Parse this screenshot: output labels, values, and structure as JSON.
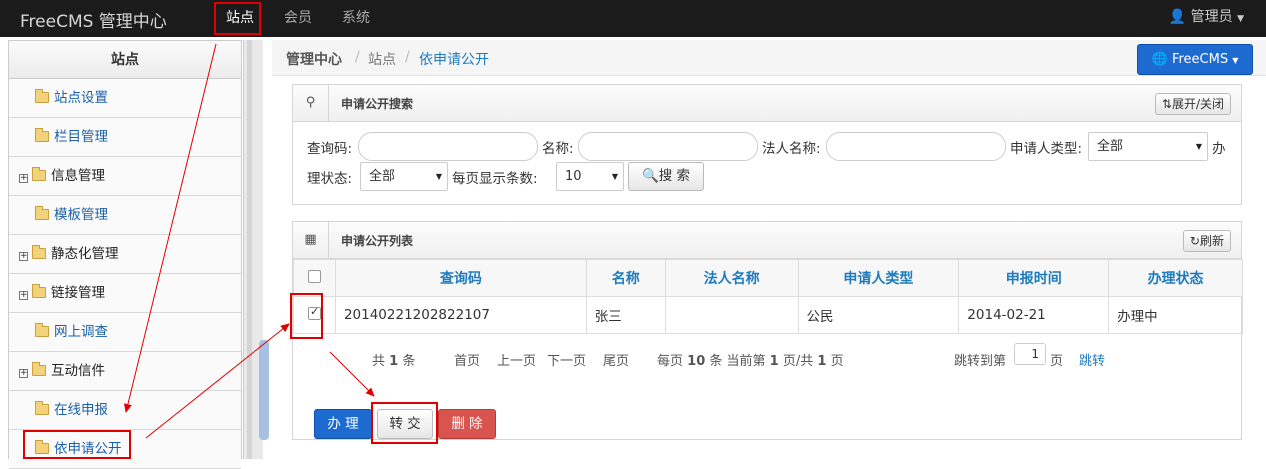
{
  "topbar": {
    "brand": "FreeCMS 管理中心",
    "nav": [
      "站点",
      "会员",
      "系统"
    ],
    "admin": "管理员"
  },
  "sidebar": {
    "title": "站点",
    "items": [
      {
        "label": "站点设置",
        "expandable": false
      },
      {
        "label": "栏目管理",
        "expandable": false
      },
      {
        "label": "信息管理",
        "expandable": true
      },
      {
        "label": "模板管理",
        "expandable": false
      },
      {
        "label": "静态化管理",
        "expandable": true
      },
      {
        "label": "链接管理",
        "expandable": true
      },
      {
        "label": "网上调查",
        "expandable": false
      },
      {
        "label": "互动信件",
        "expandable": true
      },
      {
        "label": "在线申报",
        "expandable": false
      },
      {
        "label": "依申请公开",
        "expandable": false
      }
    ]
  },
  "breadcrumb": {
    "items": [
      "管理中心",
      "站点",
      "依申请公开"
    ],
    "separator": "/"
  },
  "freecms_button": "FreeCMS",
  "search_panel": {
    "title": "申请公开搜索",
    "toggle_label": "展开/关闭",
    "query_code_label": "查询码:",
    "name_label": "名称:",
    "legal_name_label": "法人名称:",
    "applicant_type_label": "申请人类型:",
    "applicant_type_value": "全部",
    "status_label_part1": "办",
    "status_label_part2": "理状态:",
    "status_value": "全部",
    "page_size_label": "每页显示条数:",
    "page_size_value": "10",
    "search_button": "搜 索"
  },
  "list_panel": {
    "title": "申请公开列表",
    "refresh_label": "刷新",
    "columns": [
      "查询码",
      "名称",
      "法人名称",
      "申请人类型",
      "申报时间",
      "办理状态"
    ],
    "rows": [
      {
        "code": "20140221202822107",
        "name": "张三",
        "legal": "",
        "type": "公民",
        "date": "2014-02-21",
        "status": "办理中",
        "checked": true
      }
    ],
    "pager": {
      "total_pre": "共",
      "total": "1",
      "total_post": "条",
      "first": "首页",
      "prev": "上一页",
      "next": "下一页",
      "last": "尾页",
      "per_pre": "每页",
      "per": "10",
      "per_mid": "条 当前第",
      "cur": "1",
      "cur_mid": "页/共",
      "pages": "1",
      "pages_post": "页",
      "jump_pre": "跳转到第",
      "jump_value": "1",
      "jump_post": "页",
      "jump_link": "跳转"
    }
  },
  "actions": {
    "handle": "办 理",
    "transfer": "转 交",
    "delete": "删 除"
  },
  "colors": {
    "primary": "#1d6bd0",
    "danger": "#d9534f",
    "highlight": "#e00000",
    "link": "#1e7bbd"
  }
}
